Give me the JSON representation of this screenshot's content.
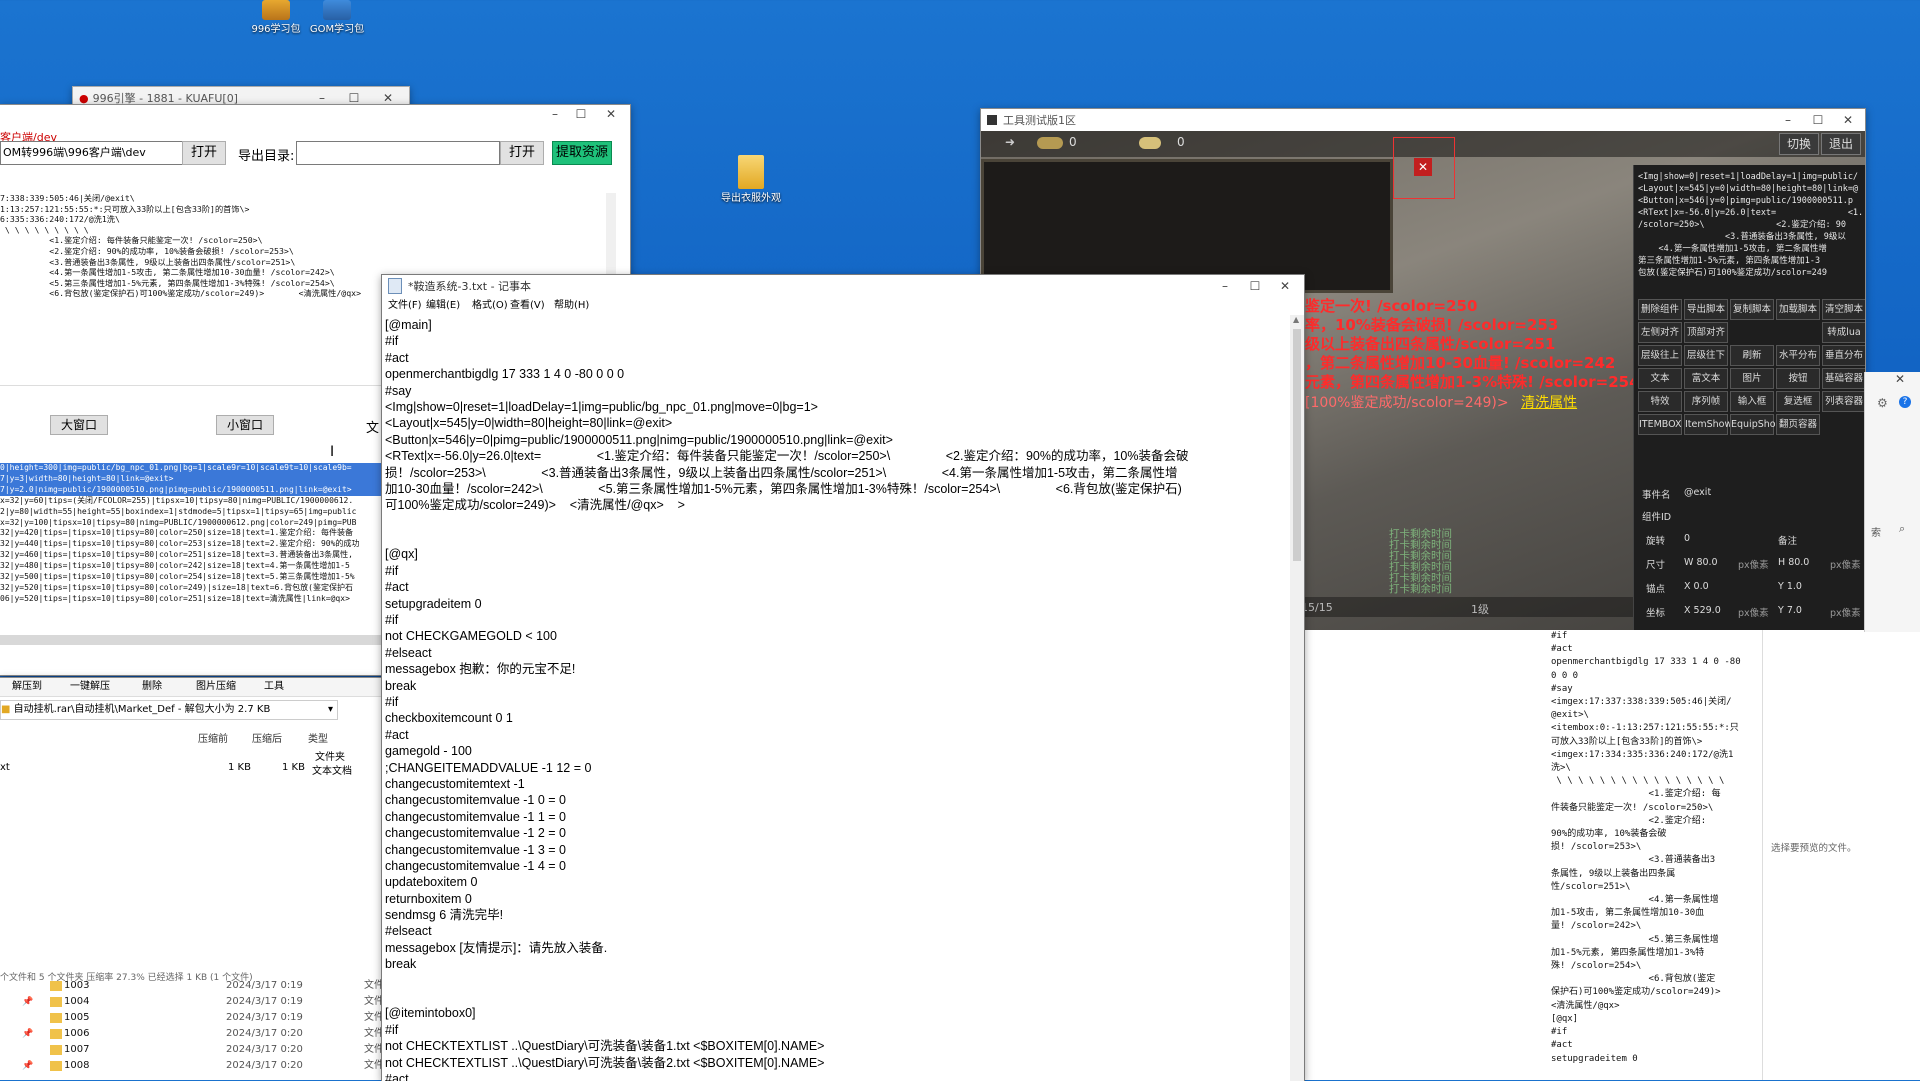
{
  "desktop": {
    "icons": [
      {
        "label": "996学习包"
      },
      {
        "label": "GOM学习包"
      },
      {
        "label": "导出衣服外观"
      }
    ]
  },
  "win_main": {
    "title": "996引擎 - 1881 - KUAFU[0]",
    "path_label": "客户端/dev",
    "path_value": "OM转996端\\996客户端\\dev",
    "open_btn": "打开",
    "export_label": "导出目录:",
    "open_btn2": "打开",
    "extract_btn": "提取资源",
    "log_lines": [
      "7:338:339:505:46|关闭/@exit\\",
      "1:13:257:121:55:55:*:只可放入33阶以上[包含33阶]的首饰\\>",
      "6:335:336:240:172/@洗1洗\\",
      " \\ \\ \\ \\ \\ \\ \\ \\ \\",
      "          <1.鉴定介绍: 每件装备只能鉴定一次! /scolor=250>\\",
      "          <2.鉴定介绍: 90%的成功率, 10%装备会破损! /scolor=253>\\",
      "          <3.普通装备出3条属性, 9级以上装备出四条属性/scolor=251>\\",
      "          <4.第一条属性增加1-5攻击, 第二条属性增加10-30血量! /scolor=242>\\",
      "          <5.第三条属性增加1-5%元素, 第四条属性增加1-3%特殊! /scolor=254>\\",
      "          <6.背包放(鉴定保护石)可100%鉴定成功/scolor=249)>       <清洗属性/@qx>"
    ],
    "big_window_btn": "大窗口",
    "small_window_btn": "小窗口",
    "wen_label": "文",
    "code_lines": [
      "0|height=300|img=public/bg_npc_01.png|bg=1|scale9r=10|scale9t=10|scale9b=",
      "7|y=3|width=80|height=80|link=@exit>",
      "7|y=2.0|nimg=public/1900000510.png|pimg=public/1900000511.png|link=@exit>",
      "x=32|y=60|tips=(关闭/FCOLOR=255)|tipsx=10|tipsy=80|nimg=PUBLIC/1900000612.",
      "2|y=80|width=55|height=55|boxindex=1|stdmode=5|tipsx=1|tipsy=65|img=public",
      "x=32|y=100|tipsx=10|tipsy=80|nimg=PUBLIC/1900000612.png|color=249|pimg=PUB",
      "32|y=420|tips=|tipsx=10|tipsy=80|color=250|size=18|text=1.鉴定介绍: 每件装备",
      "32|y=440|tips=|tipsx=10|tipsy=80|color=253|size=18|text=2.鉴定介绍: 90%的成功",
      "32|y=460|tips=|tipsx=10|tipsy=80|color=251|size=18|text=3.普通装备出3条属性,",
      "32|y=480|tips=|tipsx=10|tipsy=80|color=242|size=18|text=4.第一条属性增加1-5",
      "32|y=500|tips=|tipsx=10|tipsy=80|color=254|size=18|text=5.第三条属性增加1-5%",
      "32|y=520|tips=|tipsx=10|tipsy=80|color=249)|size=18|text=6.背包放(鉴定保护石",
      "06|y=520|tips=|tipsx=10|tipsy=80|color=251|size=18|text=清洗属性|link=@qx>"
    ]
  },
  "file_manager": {
    "toolbar": [
      "解压到",
      "一键解压",
      "删除",
      "图片压缩",
      "工具"
    ],
    "path": "自动挂机.rar\\自动挂机\\Market_Def - 解包大小为 2.7 KB",
    "columns": [
      "压缩前",
      "压缩后",
      "类型"
    ],
    "folder_type": "文件夹",
    "file_row": {
      "name": "xt",
      "before": "1 KB",
      "after": "1 KB",
      "type": "文本文档"
    },
    "status": "个文件和 5 个文件夹 压缩率 27.3% 已经选择 1 KB (1 个文件)"
  },
  "explorer": {
    "rows": [
      {
        "name": "1003",
        "date": "2024/3/17 0:19",
        "type": "文件"
      },
      {
        "name": "1004",
        "date": "2024/3/17 0:19",
        "type": "文件"
      },
      {
        "name": "1005",
        "date": "2024/3/17 0:19",
        "type": "文件"
      },
      {
        "name": "1006",
        "date": "2024/3/17 0:20",
        "type": "文件"
      },
      {
        "name": "1007",
        "date": "2024/3/17 0:20",
        "type": "文件"
      },
      {
        "name": "1008",
        "date": "2024/3/17 0:20",
        "type": "文件"
      }
    ]
  },
  "notepad": {
    "title": "*鞍造系统-3.txt - 记事本",
    "menu": [
      "文件(F)",
      "编辑(E)",
      "格式(O)",
      "查看(V)",
      "帮助(H)"
    ],
    "lines": [
      "[@main]",
      "#if",
      "#act",
      "openmerchantbigdlg 17 333 1 4 0 -80 0 0 0",
      "#say",
      "<Img|show=0|reset=1|loadDelay=1|img=public/bg_npc_01.png|move=0|bg=1>",
      "<Layout|x=545|y=0|width=80|height=80|link=@exit>",
      "<Button|x=546|y=0|pimg=public/1900000511.png|nimg=public/1900000510.png|link=@exit>",
      "<RText|x=-56.0|y=26.0|text=                <1.鉴定介绍：每件装备只能鉴定一次！/scolor=250>\\                <2.鉴定介绍：90%的成功率，10%装备会破",
      "损！/scolor=253>\\                <3.普通装备出3条属性，9级以上装备出四条属性/scolor=251>\\                <4.第一条属性增加1-5攻击，第二条属性增",
      "加10-30血量！/scolor=242>\\                <5.第三条属性增加1-5%元素，第四条属性增加1-3%特殊！/scolor=254>\\                <6.背包放(鉴定保护石)",
      "可100%鉴定成功/scolor=249)>    <清洗属性/@qx>    >",
      "",
      "",
      "[@qx]",
      "#if",
      "#act",
      "setupgradeitem 0",
      "#if",
      "not CHECKGAMEGOLD < 100",
      "#elseact",
      "messagebox 抱歉：你的元宝不足!",
      "break",
      "#if",
      "checkboxitemcount 0 1",
      "#act",
      "gamegold - 100",
      ";CHANGEITEMADDVALUE -1 12 = 0",
      "changecustomitemtext -1",
      "changecustomitemvalue -1 0 = 0",
      "changecustomitemvalue -1 1 = 0",
      "changecustomitemvalue -1 2 = 0",
      "changecustomitemvalue -1 3 = 0",
      "changecustomitemvalue -1 4 = 0",
      "updateboxitem 0",
      "returnboxitem 0",
      "sendmsg 6 清洗完毕!",
      "#elseact",
      "messagebox [友情提示]：请先放入装备.",
      "break",
      "",
      "",
      "[@itemintobox0]",
      "#if",
      "not CHECKTEXTLIST ..\\QuestDiary\\可洗装备\\装备1.txt <$BOXITEM[0].NAME>",
      "not CHECKTEXTLIST ..\\QuestDiary\\可洗装备\\装备2.txt <$BOXITEM[0].NAME>",
      "#act"
    ]
  },
  "game_window": {
    "title": "工具测试版1区",
    "top_nums": [
      "0",
      "0"
    ],
    "switch_btn": "切换",
    "exit_btn": "退出",
    "red_lines": [
      "鉴定一次! /scolor=250",
      "率，10%装备会破损! /scolor=253",
      "级以上装备出四条属性/scolor=251",
      "，第二条属性增加10-30血量! /scolor=242",
      "元素，第四条属性增加1-3%特殊! /scolor=254"
    ],
    "last_line": "[100%鉴定成功/scolor=249)>",
    "last_link": "清洗属性",
    "hp_text": "15/15",
    "level_text": "1级",
    "timer_lines": [
      "打卡剩余时间",
      "打卡剩余时间",
      "打卡剩余时间",
      "打卡剩余时间",
      "打卡剩余时间",
      "打卡剩余时间"
    ],
    "code_preview": [
      "<Img|show=0|reset=1|loadDelay=1|img=public/",
      "<Layout|x=545|y=0|width=80|height=80|link=@",
      "<Button|x=546|y=0|pimg=public/1900000511.p",
      "<RText|x=-56.0|y=26.0|text=              <1.鉴",
      "/scolor=250>\\              <2.鉴定介绍: 90",
      "                 <3.普通装备出3条属性, 9级以",
      "    <4.第一条属性增加1-5攻击, 第二条属性增",
      "第三条属性增加1-5%元素, 第四条属性增加1-3",
      "包放(鉴定保护石)可100%鉴定成功/scolor=249"
    ],
    "tool_btns": [
      [
        "删除组件",
        "导出脚本",
        "复制脚本",
        "加载脚本",
        "清空脚本"
      ],
      [
        "左侧对齐",
        "顶部对齐",
        "",
        "",
        "转成lua"
      ],
      [
        "层级往上",
        "层级往下",
        "刷新",
        "水平分布",
        "垂直分布"
      ],
      [
        "文本",
        "富文本",
        "图片",
        "按钮",
        "基础容器"
      ],
      [
        "特效",
        "序列帧",
        "输入框",
        "复选框",
        "列表容器"
      ],
      [
        "ITEMBOX",
        "ItemShow",
        "EquipShow",
        "翻页容器",
        ""
      ]
    ],
    "props": {
      "event_label": "事件名",
      "event_value": "@exit",
      "comp_label": "组件ID",
      "rotate_label": "旋转",
      "rotate_value": "0",
      "note_label": "备注",
      "size_label": "尺寸",
      "w_label": "W",
      "w_value": "80.0",
      "w_unit": "px像素",
      "h_label": "H",
      "h_value": "80.0",
      "h_unit": "px像素",
      "anchor_label": "锚点",
      "ax_label": "X",
      "ax_value": "0.0",
      "ay_label": "Y",
      "ay_value": "1.0",
      "coord_label": "坐标",
      "cx_label": "X",
      "cx_value": "529.0",
      "cx_unit": "px像素",
      "cy_label": "Y",
      "cy_value": "7.0",
      "cy_unit": "px像素"
    }
  },
  "preview_pane": {
    "lines": [
      "#if",
      "#act",
      "openmerchantbigdlg 17 333 1 4 0 -80",
      "0 0 0",
      "#say",
      "<imgex:17:337:338:339:505:46|关闭/",
      "@exit>\\",
      "<itembox:0:-1:13:257:121:55:55:*:只",
      "可放入33阶以上[包含33阶]的首饰\\>",
      "<imgex:17:334:335:336:240:172/@洗1",
      "洗>\\",
      " \\ \\ \\ \\ \\ \\ \\ \\ \\ \\ \\ \\ \\ \\ \\ \\",
      "                  <1.鉴定介绍: 每",
      "件装备只能鉴定一次! /scolor=250>\\",
      "                  <2.鉴定介绍:",
      "90%的成功率, 10%装备会破",
      "损! /scolor=253>\\",
      "                  <3.普通装备出3",
      "条属性, 9级以上装备出四条属",
      "性/scolor=251>\\",
      "                  <4.第一条属性增",
      "加1-5攻击, 第二条属性增加10-30血",
      "量! /scolor=242>\\",
      "                  <5.第三条属性增",
      "加1-5%元素, 第四条属性增加1-3%特",
      "殊! /scolor=254>\\",
      "                  <6.背包放(鉴定",
      "保护石)可100%鉴定成功/scolor=249)>",
      "<清洗属性/@qx>",
      "",
      "[@qx]",
      "#if",
      "#act",
      "setupgradeitem 0"
    ],
    "hint": "选择要预览的文件。",
    "search_label": "索"
  }
}
